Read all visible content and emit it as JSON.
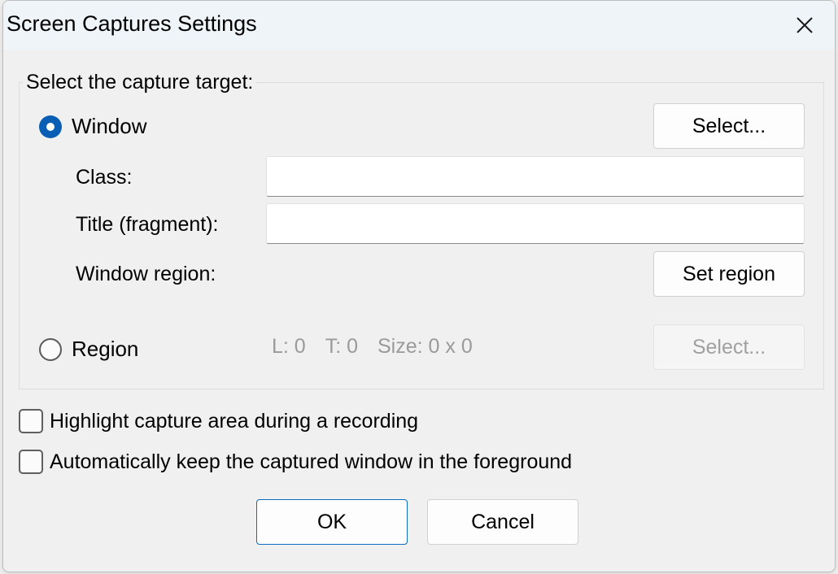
{
  "dialog": {
    "title": "Screen Captures Settings",
    "close_icon": "close-icon"
  },
  "capture_target": {
    "caption": "Select the capture target:",
    "window_option": {
      "label": "Window",
      "checked": true,
      "select_button": "Select..."
    },
    "fields": {
      "class_label": "Class:",
      "class_value": "",
      "title_label": "Title (fragment):",
      "title_value": "",
      "window_region_label": "Window region:",
      "set_region_button": "Set region"
    },
    "region_option": {
      "label": "Region",
      "checked": false,
      "left": "L: 0",
      "top": "T: 0",
      "size": "Size: 0 x 0",
      "select_button": "Select..."
    }
  },
  "options": {
    "highlight_label": "Highlight capture area during a recording",
    "highlight_checked": false,
    "foreground_label": "Automatically keep the captured window in the foreground",
    "foreground_checked": false
  },
  "buttons": {
    "ok": "OK",
    "cancel": "Cancel"
  },
  "colors": {
    "accent": "#0a5fb4",
    "titlebar": "#eff4f9",
    "dialog_bg": "#f0f0f0",
    "disabled_text": "#9a9a9a"
  }
}
